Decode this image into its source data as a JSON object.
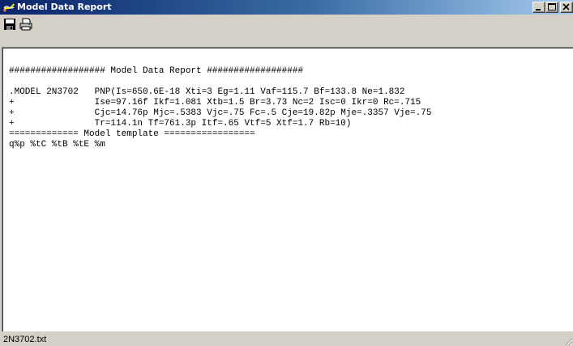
{
  "window": {
    "title": "Model Data Report"
  },
  "toolbar": {
    "save_icon": "save-icon",
    "print_icon": "print-icon"
  },
  "report": {
    "lines": [
      "",
      "################## Model Data Report ##################",
      "",
      ".MODEL 2N3702   PNP(Is=650.6E-18 Xti=3 Eg=1.11 Vaf=115.7 Bf=133.8 Ne=1.832",
      "+               Ise=97.16f Ikf=1.081 Xtb=1.5 Br=3.73 Nc=2 Isc=0 Ikr=0 Rc=.715",
      "+               Cjc=14.76p Mjc=.5383 Vjc=.75 Fc=.5 Cje=19.82p Mje=.3357 Vje=.75",
      "+               Tr=114.1n Tf=761.3p Itf=.65 Vtf=5 Xtf=1.7 Rb=10)",
      "============= Model template =================",
      "q%p %tC %tB %tE %m"
    ]
  },
  "status": {
    "filename": "2N3702.txt"
  },
  "colors": {
    "titlebar_start": "#0a246a",
    "titlebar_end": "#a6caf0",
    "chrome": "#d4d0c8"
  }
}
